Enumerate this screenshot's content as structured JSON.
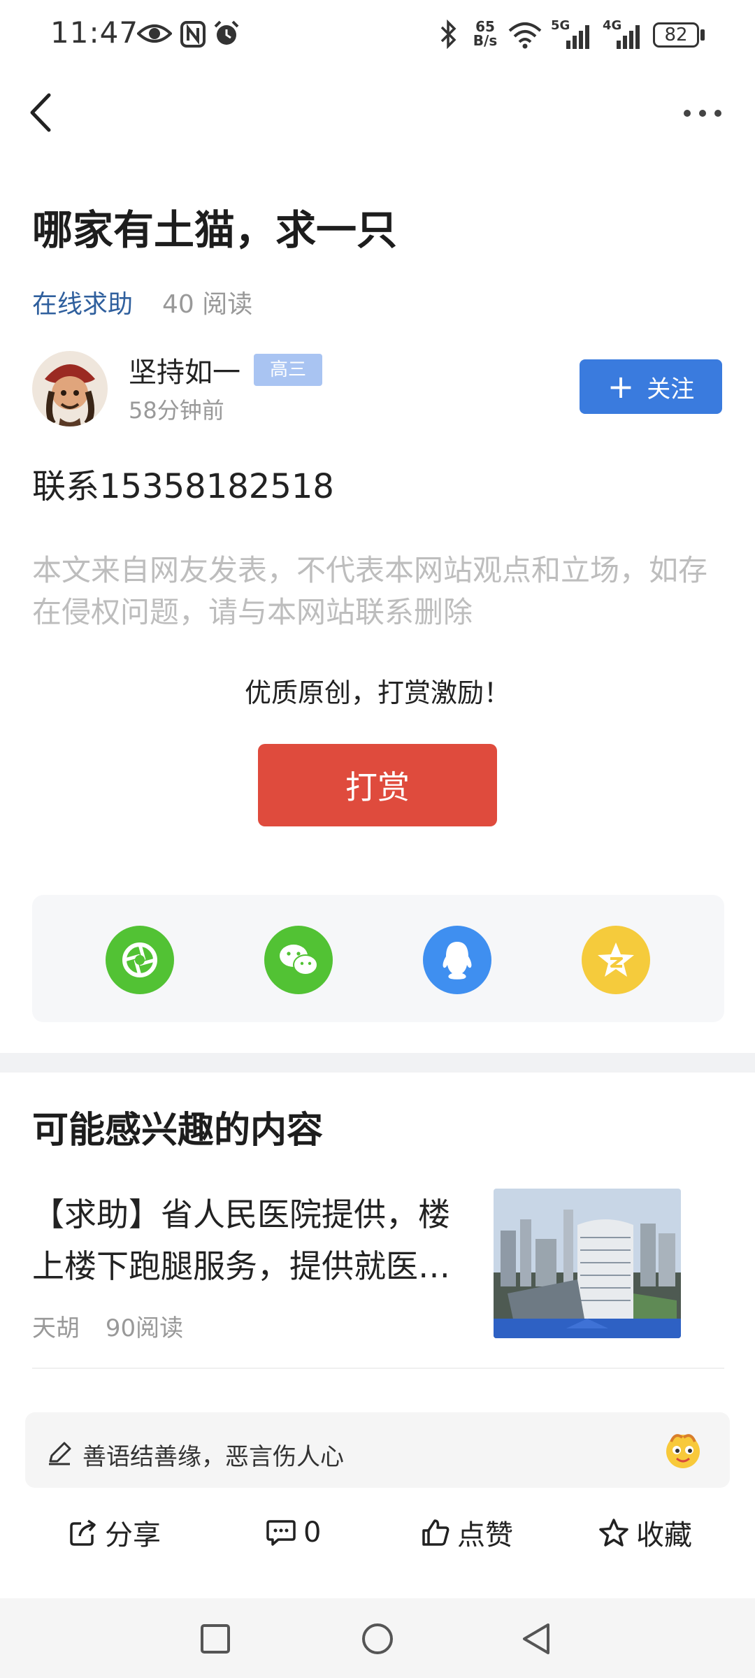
{
  "status_bar": {
    "time": "11:47",
    "net_speed_top": "65",
    "net_speed_bottom": "B/s",
    "signal_1": "5G",
    "signal_2": "4G",
    "battery": "82"
  },
  "post": {
    "title": "哪家有土猫，求一只",
    "category": "在线求助",
    "reads": "40 阅读",
    "author": "坚持如一",
    "grade_badge": "高三",
    "time": "58分钟前",
    "follow_label": "关注",
    "body": "联系15358182518",
    "disclaimer": "本文来自网友发表，不代表本网站观点和立场，如存在侵权问题，请与本网站联系删除"
  },
  "reward": {
    "prompt": "优质原创，打赏激励！",
    "button_label": "打赏"
  },
  "share": {
    "icons": [
      "moments-icon",
      "wechat-icon",
      "qq-icon",
      "qzone-icon"
    ],
    "colors": {
      "moments": "#52c234",
      "wechat": "#52c234",
      "qq": "#3f8ff0",
      "qzone": "#f5cb3c"
    }
  },
  "related": {
    "heading": "可能感兴趣的内容",
    "items": [
      {
        "title": "【求助】省人民医院提供，楼上楼下跑腿服务，提供就医…",
        "author": "天胡",
        "reads": "90阅读"
      }
    ]
  },
  "comment_bar": {
    "placeholder": "善语结善缘，恶言伤人心"
  },
  "actions": {
    "share_label": "分享",
    "comment_count": "0",
    "like_label": "点赞",
    "favorite_label": "收藏"
  },
  "colors": {
    "accent_blue": "#3a7bde",
    "reward_red": "#df4b3d",
    "category_blue": "#2f5f9d"
  }
}
